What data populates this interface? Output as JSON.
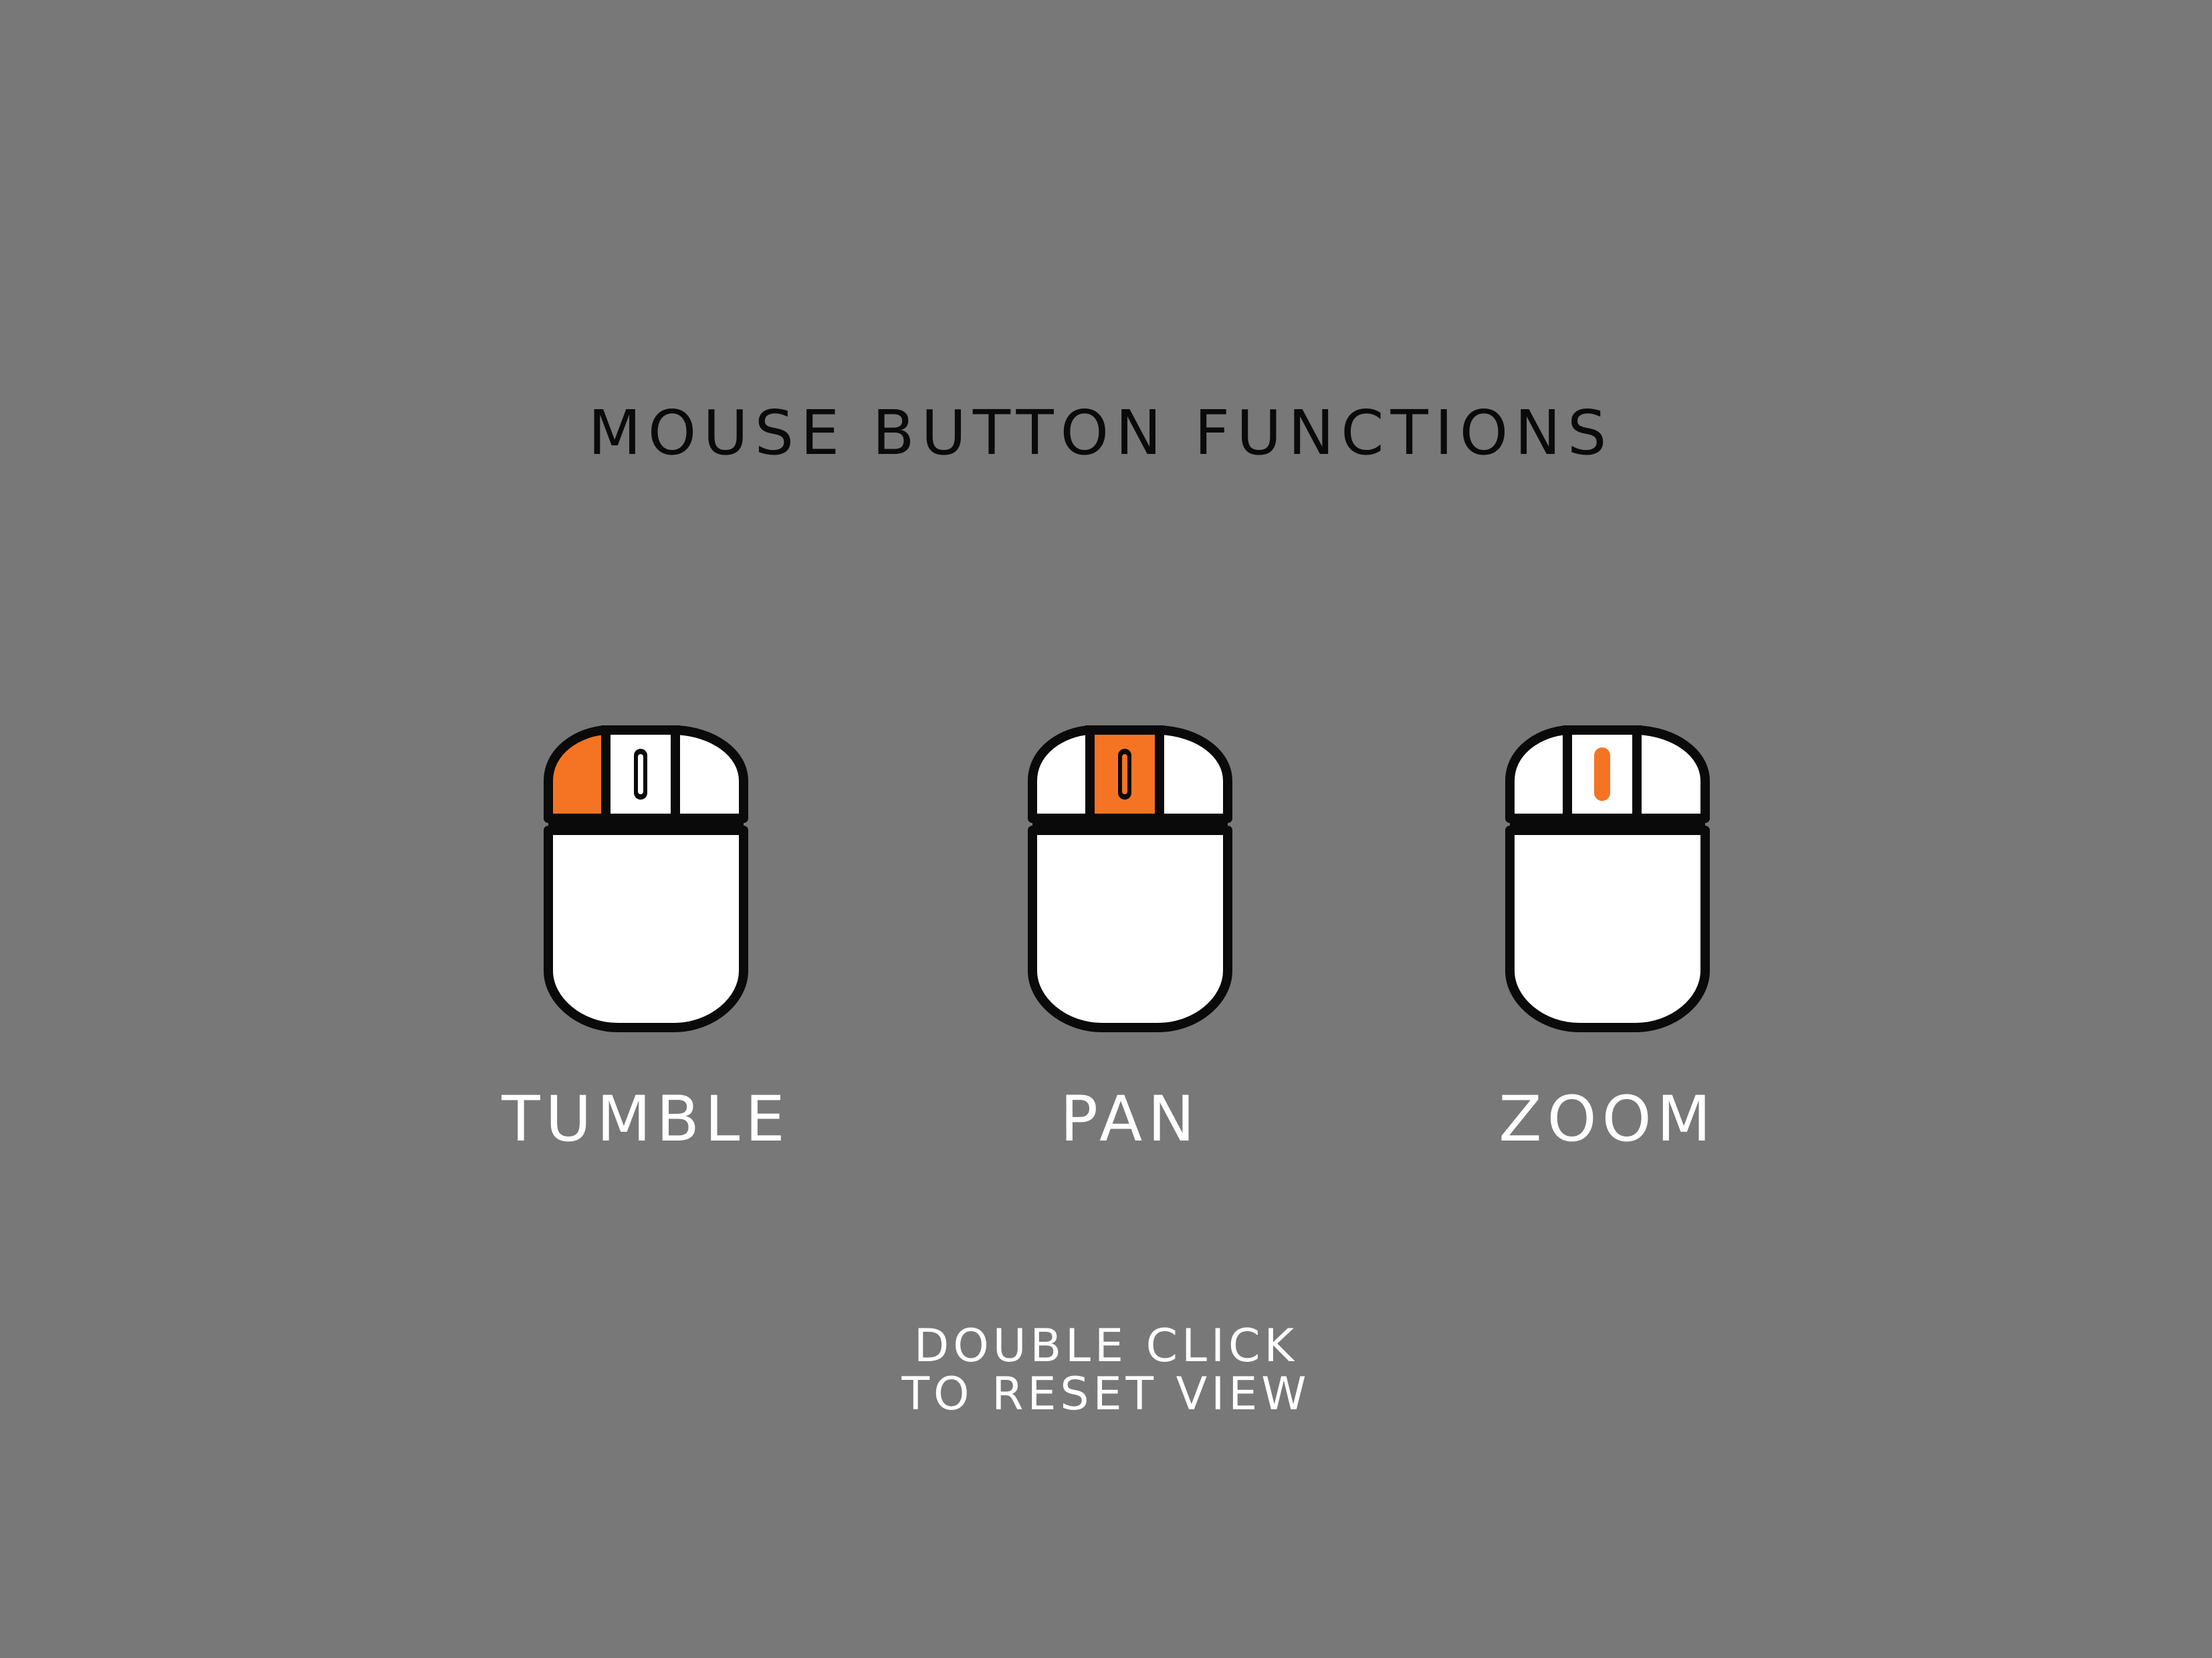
{
  "header": {
    "title": "MOUSE BUTTON FUNCTIONS"
  },
  "colors": {
    "background": "#787878",
    "accent": "#F47423",
    "mouse_body": "#FFFFFF",
    "outline": "#0A0A0A"
  },
  "mice": [
    {
      "label": "TUMBLE",
      "icon": "mouse-left-button-icon",
      "highlight": "left-button"
    },
    {
      "label": "PAN",
      "icon": "mouse-middle-button-icon",
      "highlight": "middle-button"
    },
    {
      "label": "ZOOM",
      "icon": "mouse-scroll-wheel-icon",
      "highlight": "scroll-wheel"
    }
  ],
  "footer": {
    "line1": "DOUBLE CLICK",
    "line2": "TO RESET VIEW"
  }
}
